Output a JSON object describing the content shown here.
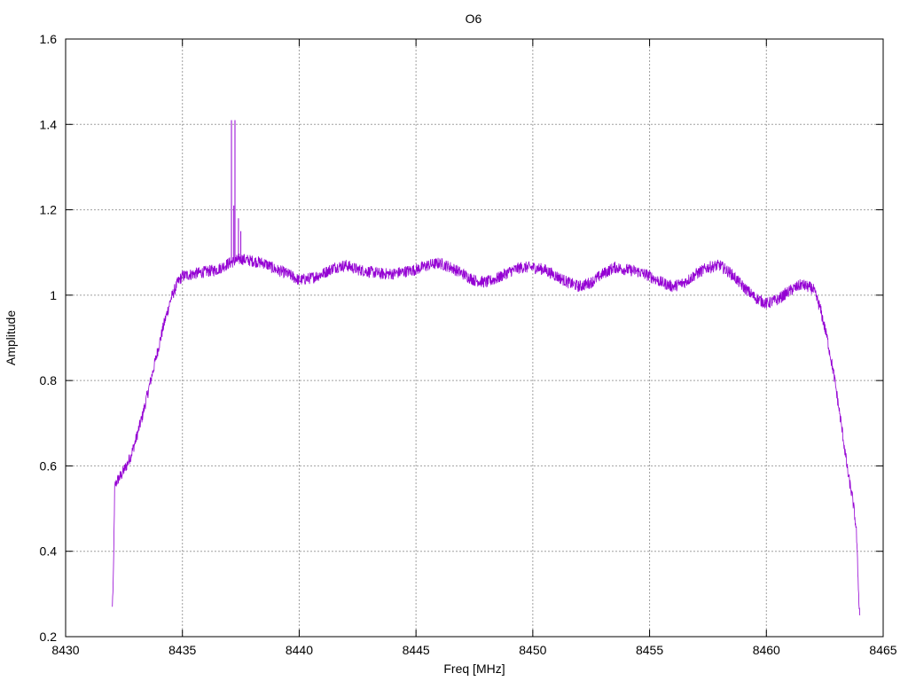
{
  "chart_data": {
    "type": "line",
    "title": "O6",
    "xlabel": "Freq [MHz]",
    "ylabel": "Amplitude",
    "xlim": [
      8430,
      8465
    ],
    "ylim": [
      0.2,
      1.6
    ],
    "x_ticks": [
      "8430",
      "8435",
      "8440",
      "8445",
      "8450",
      "8455",
      "8460",
      "8465"
    ],
    "y_ticks": [
      "0.2",
      "0.4",
      "0.6",
      "0.8",
      "1",
      "1.2",
      "1.4",
      "1.6"
    ],
    "grid": true,
    "series": [
      {
        "color": "#9400d3",
        "points": [
          [
            8432.0,
            0.27
          ],
          [
            8432.05,
            0.35
          ],
          [
            8432.1,
            0.55
          ],
          [
            8432.2,
            0.565
          ],
          [
            8432.4,
            0.58
          ],
          [
            8432.6,
            0.6
          ],
          [
            8432.8,
            0.625
          ],
          [
            8433.0,
            0.66
          ],
          [
            8433.3,
            0.72
          ],
          [
            8433.6,
            0.79
          ],
          [
            8433.9,
            0.86
          ],
          [
            8434.2,
            0.93
          ],
          [
            8434.5,
            0.99
          ],
          [
            8434.8,
            1.03
          ],
          [
            8435.0,
            1.045
          ],
          [
            8435.5,
            1.05
          ],
          [
            8436.0,
            1.055
          ],
          [
            8436.5,
            1.06
          ],
          [
            8437.0,
            1.075
          ],
          [
            8437.5,
            1.085
          ],
          [
            8438.0,
            1.08
          ],
          [
            8438.5,
            1.075
          ],
          [
            8439.0,
            1.06
          ],
          [
            8439.5,
            1.05
          ],
          [
            8440.0,
            1.035
          ],
          [
            8440.5,
            1.04
          ],
          [
            8441.0,
            1.05
          ],
          [
            8441.5,
            1.065
          ],
          [
            8442.0,
            1.07
          ],
          [
            8442.5,
            1.06
          ],
          [
            8443.0,
            1.055
          ],
          [
            8443.5,
            1.05
          ],
          [
            8444.0,
            1.05
          ],
          [
            8444.5,
            1.055
          ],
          [
            8445.0,
            1.06
          ],
          [
            8445.5,
            1.07
          ],
          [
            8446.0,
            1.075
          ],
          [
            8446.5,
            1.065
          ],
          [
            8447.0,
            1.05
          ],
          [
            8447.5,
            1.035
          ],
          [
            8448.0,
            1.03
          ],
          [
            8448.5,
            1.04
          ],
          [
            8449.0,
            1.055
          ],
          [
            8449.5,
            1.065
          ],
          [
            8450.0,
            1.065
          ],
          [
            8450.5,
            1.06
          ],
          [
            8451.0,
            1.045
          ],
          [
            8451.5,
            1.03
          ],
          [
            8452.0,
            1.02
          ],
          [
            8452.5,
            1.03
          ],
          [
            8453.0,
            1.05
          ],
          [
            8453.5,
            1.065
          ],
          [
            8454.0,
            1.06
          ],
          [
            8454.5,
            1.055
          ],
          [
            8455.0,
            1.045
          ],
          [
            8455.5,
            1.03
          ],
          [
            8456.0,
            1.02
          ],
          [
            8456.5,
            1.03
          ],
          [
            8457.0,
            1.05
          ],
          [
            8457.5,
            1.065
          ],
          [
            8458.0,
            1.07
          ],
          [
            8458.5,
            1.05
          ],
          [
            8459.0,
            1.02
          ],
          [
            8459.5,
            0.995
          ],
          [
            8460.0,
            0.98
          ],
          [
            8460.5,
            0.99
          ],
          [
            8461.0,
            1.01
          ],
          [
            8461.5,
            1.025
          ],
          [
            8462.0,
            1.015
          ],
          [
            8462.3,
            0.97
          ],
          [
            8462.6,
            0.9
          ],
          [
            8462.9,
            0.81
          ],
          [
            8463.2,
            0.7
          ],
          [
            8463.5,
            0.58
          ],
          [
            8463.7,
            0.52
          ],
          [
            8463.85,
            0.45
          ],
          [
            8463.95,
            0.3
          ],
          [
            8464.0,
            0.25
          ]
        ]
      }
    ],
    "spikes": [
      {
        "x": 8437.1,
        "y": 1.41
      },
      {
        "x": 8437.25,
        "y": 1.41
      },
      {
        "x": 8437.2,
        "y": 1.21
      },
      {
        "x": 8437.4,
        "y": 1.18
      },
      {
        "x": 8437.5,
        "y": 1.15
      }
    ]
  }
}
